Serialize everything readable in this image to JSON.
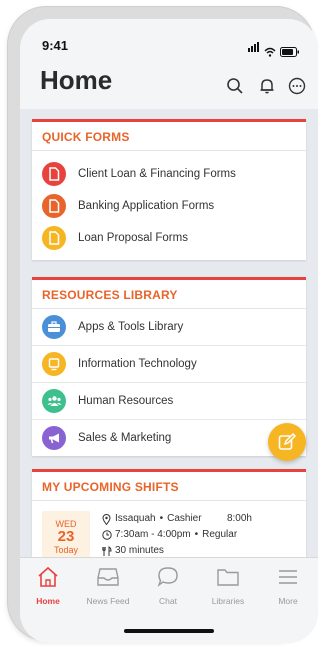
{
  "status_bar": {
    "time": "9:41"
  },
  "header": {
    "title": "Home",
    "icons": [
      "search-icon",
      "bell-icon",
      "more-icon"
    ]
  },
  "quick_forms": {
    "title": "QUICK FORMS",
    "items": [
      {
        "label": "Client Loan & Financing Forms",
        "color": "#e8423f",
        "icon": "document-icon"
      },
      {
        "label": "Banking Application Forms",
        "color": "#e8642a",
        "icon": "document-icon"
      },
      {
        "label": "Loan Proposal Forms",
        "color": "#f6b523",
        "icon": "document-icon"
      }
    ]
  },
  "resources": {
    "title": "RESOURCES LIBRARY",
    "items": [
      {
        "label": "Apps & Tools Library",
        "color": "#4a90d9",
        "icon": "briefcase-icon"
      },
      {
        "label": "Information Technology",
        "color": "#f6b523",
        "icon": "monitor-icon"
      },
      {
        "label": "Human Resources",
        "color": "#3ec08e",
        "icon": "people-icon"
      },
      {
        "label": "Sales & Marketing",
        "color": "#8a63d2",
        "icon": "megaphone-icon"
      }
    ]
  },
  "shifts": {
    "title": "MY UPCOMING SHIFTS",
    "shift": {
      "dow": "WED",
      "day": "23",
      "relative": "Today",
      "location": "Issaquah",
      "role": "Cashier",
      "duration": "8:00h",
      "time_range": "7:30am - 4:00pm",
      "type": "Regular",
      "break": "30 minutes",
      "separator": "•"
    }
  },
  "tabs": [
    {
      "label": "Home",
      "icon": "home-icon",
      "active": true
    },
    {
      "label": "News Feed",
      "icon": "inbox-icon",
      "active": false
    },
    {
      "label": "Chat",
      "icon": "chat-icon",
      "active": false
    },
    {
      "label": "Libraries",
      "icon": "folder-icon",
      "active": false
    },
    {
      "label": "More",
      "icon": "menu-icon",
      "active": false
    }
  ],
  "colors": {
    "accent": "#e8423f",
    "section_title": "#e8642a",
    "fab": "#f6b523"
  }
}
